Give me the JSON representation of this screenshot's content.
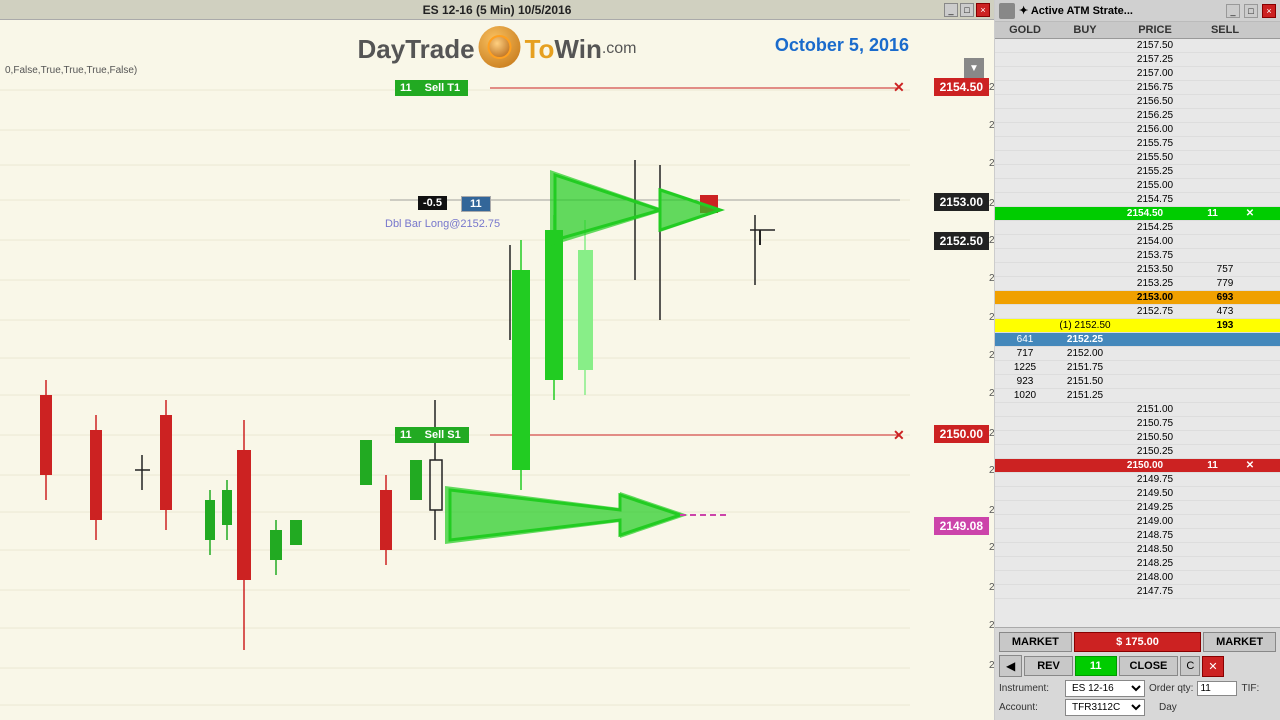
{
  "chart": {
    "title": "ES 12-16 (5 Min)  10/5/2016",
    "date": "October 5, 2016",
    "bool_text": "0,False,True,True,True,False)",
    "dbl_bar_label": "Dbl Bar Long@2152.75",
    "indicator_neg": "-0.5",
    "indicator_pos": "11",
    "prices": {
      "sell_t1": "2154.50",
      "sell_s1": "2150.00",
      "current": "2153.00",
      "mid": "2152.50",
      "target": "2149.08"
    },
    "sell_t1_qty": "11",
    "sell_t1_label": "Sell T1",
    "sell_s1_qty": "11",
    "sell_s1_label": "Sell S1"
  },
  "order_book": {
    "headers": [
      "GOLD",
      "BUY",
      "PRICE",
      "SELL"
    ],
    "rows": [
      {
        "gold": "",
        "buy": "",
        "price": "2157.50",
        "sell": ""
      },
      {
        "gold": "",
        "buy": "",
        "price": "2157.25",
        "sell": ""
      },
      {
        "gold": "",
        "buy": "",
        "price": "2157.00",
        "sell": ""
      },
      {
        "gold": "",
        "buy": "",
        "price": "2156.75",
        "sell": ""
      },
      {
        "gold": "",
        "buy": "",
        "price": "2156.50",
        "sell": ""
      },
      {
        "gold": "",
        "buy": "",
        "price": "2156.25",
        "sell": ""
      },
      {
        "gold": "",
        "buy": "",
        "price": "2156.00",
        "sell": ""
      },
      {
        "gold": "",
        "buy": "",
        "price": "2155.75",
        "sell": ""
      },
      {
        "gold": "",
        "buy": "",
        "price": "2155.50",
        "sell": ""
      },
      {
        "gold": "",
        "buy": "",
        "price": "2155.25",
        "sell": ""
      },
      {
        "gold": "",
        "buy": "",
        "price": "2155.00",
        "sell": ""
      },
      {
        "gold": "",
        "buy": "",
        "price": "2154.75",
        "sell": ""
      },
      {
        "gold": "",
        "buy": "",
        "price": "2154.50",
        "sell": "",
        "highlight": "green",
        "qty_right": "11"
      },
      {
        "gold": "",
        "buy": "",
        "price": "2154.25",
        "sell": ""
      },
      {
        "gold": "",
        "buy": "",
        "price": "2154.00",
        "sell": ""
      },
      {
        "gold": "",
        "buy": "",
        "price": "2153.75",
        "sell": ""
      },
      {
        "gold": "",
        "buy": "",
        "price": "2153.50",
        "sell": "757"
      },
      {
        "gold": "",
        "buy": "",
        "price": "2153.25",
        "sell": "779"
      },
      {
        "gold": "",
        "buy": "",
        "price": "2153.00",
        "sell": "693",
        "highlight": "orange"
      },
      {
        "gold": "",
        "buy": "",
        "price": "2152.75",
        "sell": "473"
      },
      {
        "gold": "",
        "buy": "",
        "price": "2152.50",
        "sell": "193",
        "highlight": "yellow"
      },
      {
        "gold": "641",
        "buy": "2152.25",
        "price": "",
        "sell": "",
        "highlight": "blue"
      },
      {
        "gold": "717",
        "buy": "2152.00",
        "price": "",
        "sell": ""
      },
      {
        "gold": "1225",
        "buy": "2151.75",
        "price": "",
        "sell": ""
      },
      {
        "gold": "923",
        "buy": "2151.50",
        "price": "",
        "sell": ""
      },
      {
        "gold": "1020",
        "buy": "2151.25",
        "price": "",
        "sell": ""
      },
      {
        "gold": "",
        "buy": "",
        "price": "2151.00",
        "sell": ""
      },
      {
        "gold": "",
        "buy": "",
        "price": "2150.75",
        "sell": ""
      },
      {
        "gold": "",
        "buy": "",
        "price": "2150.50",
        "sell": ""
      },
      {
        "gold": "",
        "buy": "",
        "price": "2150.25",
        "sell": ""
      },
      {
        "gold": "",
        "buy": "",
        "price": "2150.00",
        "sell": "",
        "highlight": "red",
        "qty_right": "11"
      },
      {
        "gold": "",
        "buy": "",
        "price": "2149.75",
        "sell": ""
      },
      {
        "gold": "",
        "buy": "",
        "price": "2149.50",
        "sell": ""
      },
      {
        "gold": "",
        "buy": "",
        "price": "2149.25",
        "sell": ""
      },
      {
        "gold": "",
        "buy": "",
        "price": "2149.00",
        "sell": ""
      },
      {
        "gold": "",
        "buy": "",
        "price": "2148.75",
        "sell": ""
      },
      {
        "gold": "",
        "buy": "",
        "price": "2148.50",
        "sell": ""
      },
      {
        "gold": "",
        "buy": "",
        "price": "2148.25",
        "sell": ""
      },
      {
        "gold": "",
        "buy": "",
        "price": "2148.00",
        "sell": ""
      },
      {
        "gold": "",
        "buy": "",
        "price": "2147.75",
        "sell": ""
      }
    ]
  },
  "controls": {
    "market_btn": "MARKET",
    "price_btn": "$ 175.00",
    "market_btn2": "MARKET",
    "rev_btn": "REV",
    "qty_display": "11",
    "close_btn": "CLOSE",
    "c_btn": "C",
    "instrument_label": "Instrument:",
    "instrument_value": "ES 12-16",
    "order_qty_label": "Order qty:",
    "order_qty_value": "11",
    "account_label": "Account:",
    "account_value": "TFR3112C"
  },
  "logo": {
    "day": "Day",
    "trade": "Trade",
    "to": "To",
    "win": "Win",
    "com": ".com"
  }
}
